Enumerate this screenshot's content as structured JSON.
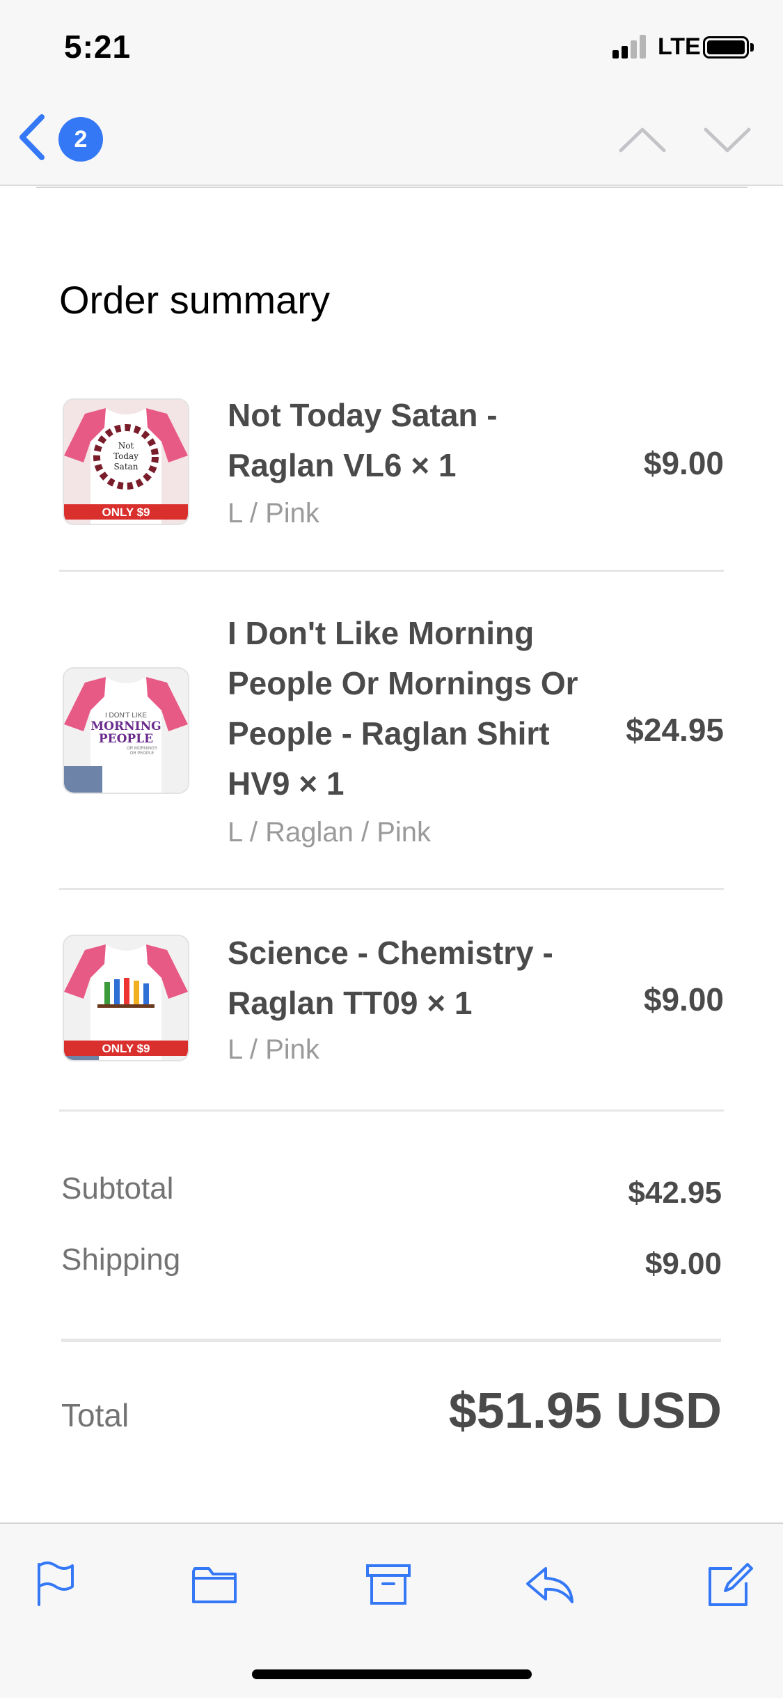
{
  "status_bar": {
    "time": "5:21",
    "network": "LTE"
  },
  "nav": {
    "message_count": "2"
  },
  "order": {
    "title": "Order summary",
    "items": [
      {
        "name": "Not Today Satan - Raglan VL6 × 1",
        "variant": "L / Pink",
        "price": "$9.00",
        "thumb": {
          "badge": "ONLY $9",
          "text": [
            "Not",
            "Today",
            "Satan"
          ]
        }
      },
      {
        "name": "I Don't Like Morning People Or Mornings Or People - Raglan Shirt HV9 × 1",
        "variant": "L / Raglan / Pink",
        "price": "$24.95",
        "thumb": {
          "text": [
            "I DON'T LIKE",
            "MORNING",
            "PEOPLE",
            "OR MORNINGS",
            "OR PEOPLE"
          ]
        }
      },
      {
        "name": "Science - Chemistry - Raglan TT09 × 1",
        "variant": "L / Pink",
        "price": "$9.00",
        "thumb": {
          "badge": "ONLY $9"
        }
      }
    ],
    "subtotal_label": "Subtotal",
    "subtotal_value": "$42.95",
    "shipping_label": "Shipping",
    "shipping_value": "$9.00",
    "total_label": "Total",
    "total_value": "$51.95 USD"
  },
  "colors": {
    "accent": "#3478f6",
    "shirt_pink": "#e85a86",
    "badge_red": "#d9302e"
  },
  "toolbar_icons": [
    "flag-icon",
    "folder-icon",
    "archive-icon",
    "reply-icon",
    "compose-icon"
  ]
}
